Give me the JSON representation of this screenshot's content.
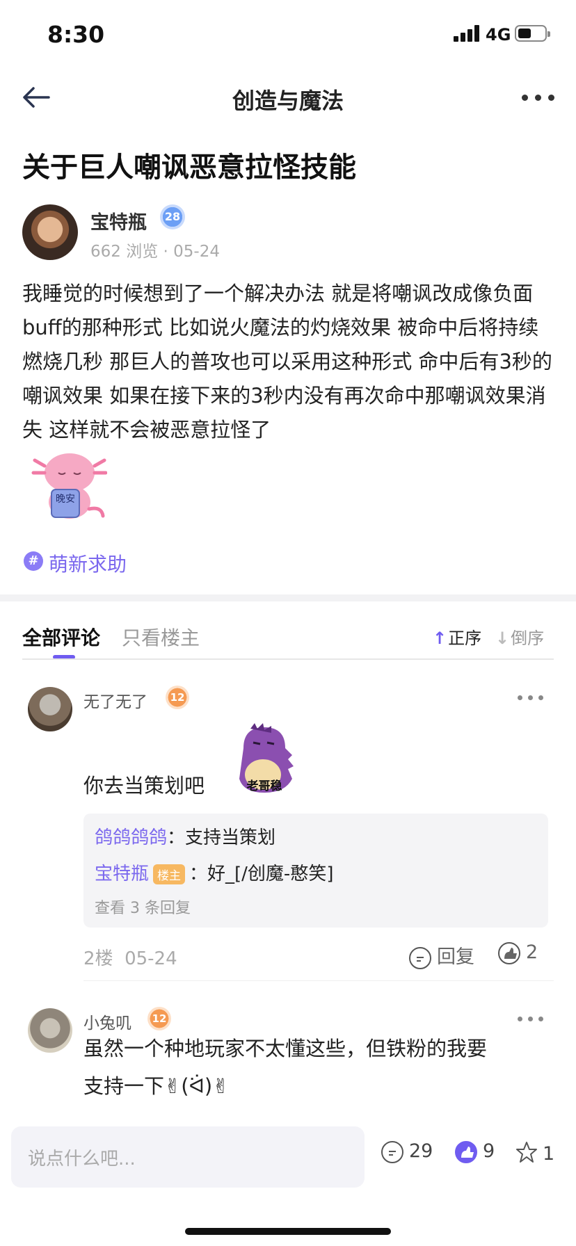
{
  "status_bar": {
    "time": "8:30",
    "network": "4G"
  },
  "nav": {
    "title": "创造与魔法"
  },
  "post": {
    "title": "关于巨人嘲讽恶意拉怪技能",
    "author": "宝特瓶",
    "author_level": "28",
    "meta": "662 浏览 · 05-24",
    "body": "我睡觉的时候想到了一个解决办法 就是将嘲讽改成像负面buff的那种形式 比如说火魔法的灼烧效果 被命中后将持续燃烧几秒 那巨人的普攻也可以采用这种形式 命中后有3秒的嘲讽效果 如果在接下来的3秒内没有再次命中那嘲讽效果消失 这样就不会被恶意拉怪了",
    "sticker_text": "晚安",
    "topic": "萌新求助"
  },
  "tabs": {
    "all": "全部评论",
    "owner_only": "只看楼主",
    "asc": "正序",
    "desc": "倒序"
  },
  "comments": [
    {
      "user": "无了无了",
      "level": "12",
      "text": "你去当策划吧",
      "sticker_text": "老哥稳",
      "replies": [
        {
          "user": "鸽鸽鸽鸽",
          "sep": "：",
          "text": "支持当策划"
        },
        {
          "user": "宝特瓶",
          "tag": "楼主",
          "sep": "：",
          "text": "好_[/创魔-憨笑]"
        }
      ],
      "view_more": "查看 3 条回复",
      "floor": "2楼",
      "date": "05-24",
      "reply_label": "回复",
      "likes": "2"
    },
    {
      "user": "小兔叽",
      "level": "12",
      "text_line1": "虽然一个种地玩家不太懂这些，但铁粉的我要",
      "text_line2": "支持一下✌(ᐛ)✌"
    }
  ],
  "bottom_bar": {
    "placeholder": "说点什么吧...",
    "comments_count": "29",
    "likes_count": "9",
    "stars_count": "1"
  }
}
